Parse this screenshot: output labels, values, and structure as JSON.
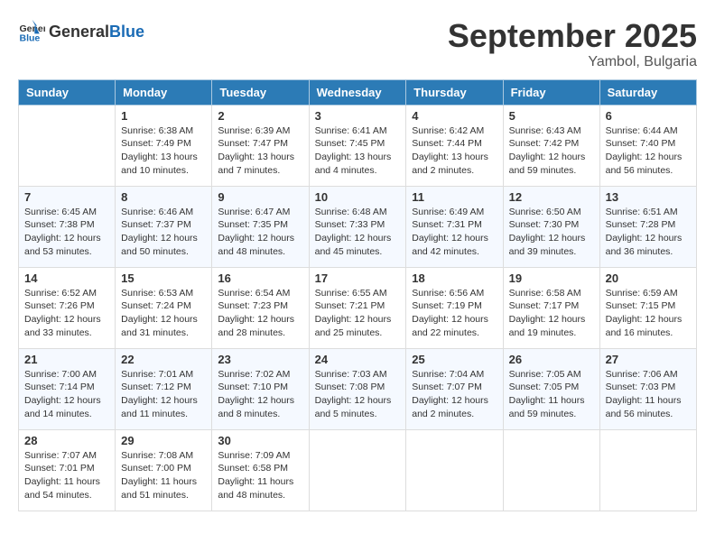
{
  "header": {
    "logo_general": "General",
    "logo_blue": "Blue",
    "month_title": "September 2025",
    "location": "Yambol, Bulgaria"
  },
  "days_of_week": [
    "Sunday",
    "Monday",
    "Tuesday",
    "Wednesday",
    "Thursday",
    "Friday",
    "Saturday"
  ],
  "weeks": [
    [
      {
        "day": "",
        "info": ""
      },
      {
        "day": "1",
        "info": "Sunrise: 6:38 AM\nSunset: 7:49 PM\nDaylight: 13 hours\nand 10 minutes."
      },
      {
        "day": "2",
        "info": "Sunrise: 6:39 AM\nSunset: 7:47 PM\nDaylight: 13 hours\nand 7 minutes."
      },
      {
        "day": "3",
        "info": "Sunrise: 6:41 AM\nSunset: 7:45 PM\nDaylight: 13 hours\nand 4 minutes."
      },
      {
        "day": "4",
        "info": "Sunrise: 6:42 AM\nSunset: 7:44 PM\nDaylight: 13 hours\nand 2 minutes."
      },
      {
        "day": "5",
        "info": "Sunrise: 6:43 AM\nSunset: 7:42 PM\nDaylight: 12 hours\nand 59 minutes."
      },
      {
        "day": "6",
        "info": "Sunrise: 6:44 AM\nSunset: 7:40 PM\nDaylight: 12 hours\nand 56 minutes."
      }
    ],
    [
      {
        "day": "7",
        "info": "Sunrise: 6:45 AM\nSunset: 7:38 PM\nDaylight: 12 hours\nand 53 minutes."
      },
      {
        "day": "8",
        "info": "Sunrise: 6:46 AM\nSunset: 7:37 PM\nDaylight: 12 hours\nand 50 minutes."
      },
      {
        "day": "9",
        "info": "Sunrise: 6:47 AM\nSunset: 7:35 PM\nDaylight: 12 hours\nand 48 minutes."
      },
      {
        "day": "10",
        "info": "Sunrise: 6:48 AM\nSunset: 7:33 PM\nDaylight: 12 hours\nand 45 minutes."
      },
      {
        "day": "11",
        "info": "Sunrise: 6:49 AM\nSunset: 7:31 PM\nDaylight: 12 hours\nand 42 minutes."
      },
      {
        "day": "12",
        "info": "Sunrise: 6:50 AM\nSunset: 7:30 PM\nDaylight: 12 hours\nand 39 minutes."
      },
      {
        "day": "13",
        "info": "Sunrise: 6:51 AM\nSunset: 7:28 PM\nDaylight: 12 hours\nand 36 minutes."
      }
    ],
    [
      {
        "day": "14",
        "info": "Sunrise: 6:52 AM\nSunset: 7:26 PM\nDaylight: 12 hours\nand 33 minutes."
      },
      {
        "day": "15",
        "info": "Sunrise: 6:53 AM\nSunset: 7:24 PM\nDaylight: 12 hours\nand 31 minutes."
      },
      {
        "day": "16",
        "info": "Sunrise: 6:54 AM\nSunset: 7:23 PM\nDaylight: 12 hours\nand 28 minutes."
      },
      {
        "day": "17",
        "info": "Sunrise: 6:55 AM\nSunset: 7:21 PM\nDaylight: 12 hours\nand 25 minutes."
      },
      {
        "day": "18",
        "info": "Sunrise: 6:56 AM\nSunset: 7:19 PM\nDaylight: 12 hours\nand 22 minutes."
      },
      {
        "day": "19",
        "info": "Sunrise: 6:58 AM\nSunset: 7:17 PM\nDaylight: 12 hours\nand 19 minutes."
      },
      {
        "day": "20",
        "info": "Sunrise: 6:59 AM\nSunset: 7:15 PM\nDaylight: 12 hours\nand 16 minutes."
      }
    ],
    [
      {
        "day": "21",
        "info": "Sunrise: 7:00 AM\nSunset: 7:14 PM\nDaylight: 12 hours\nand 14 minutes."
      },
      {
        "day": "22",
        "info": "Sunrise: 7:01 AM\nSunset: 7:12 PM\nDaylight: 12 hours\nand 11 minutes."
      },
      {
        "day": "23",
        "info": "Sunrise: 7:02 AM\nSunset: 7:10 PM\nDaylight: 12 hours\nand 8 minutes."
      },
      {
        "day": "24",
        "info": "Sunrise: 7:03 AM\nSunset: 7:08 PM\nDaylight: 12 hours\nand 5 minutes."
      },
      {
        "day": "25",
        "info": "Sunrise: 7:04 AM\nSunset: 7:07 PM\nDaylight: 12 hours\nand 2 minutes."
      },
      {
        "day": "26",
        "info": "Sunrise: 7:05 AM\nSunset: 7:05 PM\nDaylight: 11 hours\nand 59 minutes."
      },
      {
        "day": "27",
        "info": "Sunrise: 7:06 AM\nSunset: 7:03 PM\nDaylight: 11 hours\nand 56 minutes."
      }
    ],
    [
      {
        "day": "28",
        "info": "Sunrise: 7:07 AM\nSunset: 7:01 PM\nDaylight: 11 hours\nand 54 minutes."
      },
      {
        "day": "29",
        "info": "Sunrise: 7:08 AM\nSunset: 7:00 PM\nDaylight: 11 hours\nand 51 minutes."
      },
      {
        "day": "30",
        "info": "Sunrise: 7:09 AM\nSunset: 6:58 PM\nDaylight: 11 hours\nand 48 minutes."
      },
      {
        "day": "",
        "info": ""
      },
      {
        "day": "",
        "info": ""
      },
      {
        "day": "",
        "info": ""
      },
      {
        "day": "",
        "info": ""
      }
    ]
  ]
}
